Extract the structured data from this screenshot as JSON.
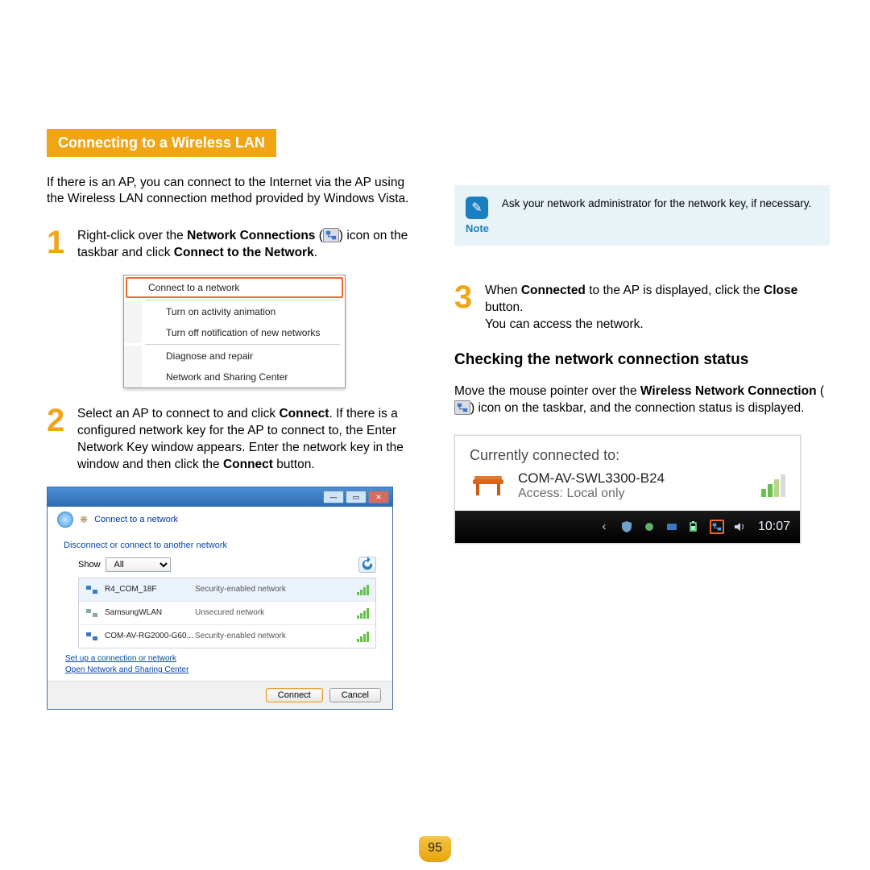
{
  "section_title": "Connecting to a Wireless LAN",
  "intro": "If there is an AP, you can connect to the Internet via the AP using the Wireless LAN connection method provided by Windows Vista.",
  "step1": {
    "pre": "Right-click over the ",
    "bold1": "Network Connections",
    "mid": " (",
    "post": ") icon on the taskbar and click ",
    "bold2": "Connect to the Network",
    "end": "."
  },
  "context_menu": {
    "items": [
      "Connect to a network",
      "Turn on activity animation",
      "Turn off notification of new networks",
      "Diagnose and repair",
      "Network and Sharing Center"
    ]
  },
  "step2": {
    "a": "Select an AP to connect to and click ",
    "b": "Connect",
    "c": ". If there is a configured network key for the AP to connect to, the Enter Network Key window appears. Enter the network key in the window and then click the ",
    "d": "Connect",
    "e": " button."
  },
  "dialog": {
    "title": "Connect to a network",
    "heading": "Disconnect or connect to another network",
    "show_label": "Show",
    "show_value": "All",
    "networks": [
      {
        "name": "R4_COM_18F",
        "security": "Security-enabled network"
      },
      {
        "name": "SamsungWLAN",
        "security": "Unsecured network"
      },
      {
        "name": "COM-AV-RG2000-G60...",
        "security": "Security-enabled network"
      }
    ],
    "link1": "Set up a connection or network",
    "link2": "Open Network and Sharing Center",
    "connect": "Connect",
    "cancel": "Cancel"
  },
  "note": {
    "label": "Note",
    "text": "Ask your network administrator for the network key, if necessary."
  },
  "step3": {
    "a": "When ",
    "b": "Connected",
    "c": " to the AP is displayed, click the ",
    "d": "Close",
    "e": " button.",
    "f": "You can access the network."
  },
  "sub_heading": "Checking the network connection status",
  "para2": {
    "a": "Move the mouse pointer over the ",
    "b": "Wireless Network Connection",
    "c": " (",
    "d": ") icon on the taskbar, and the connection status is displayed."
  },
  "tooltip": {
    "title": "Currently connected to:",
    "name": "COM-AV-SWL3300-B24",
    "access": "Access:  Local only"
  },
  "taskbar_time": "10:07",
  "page_number": "95"
}
